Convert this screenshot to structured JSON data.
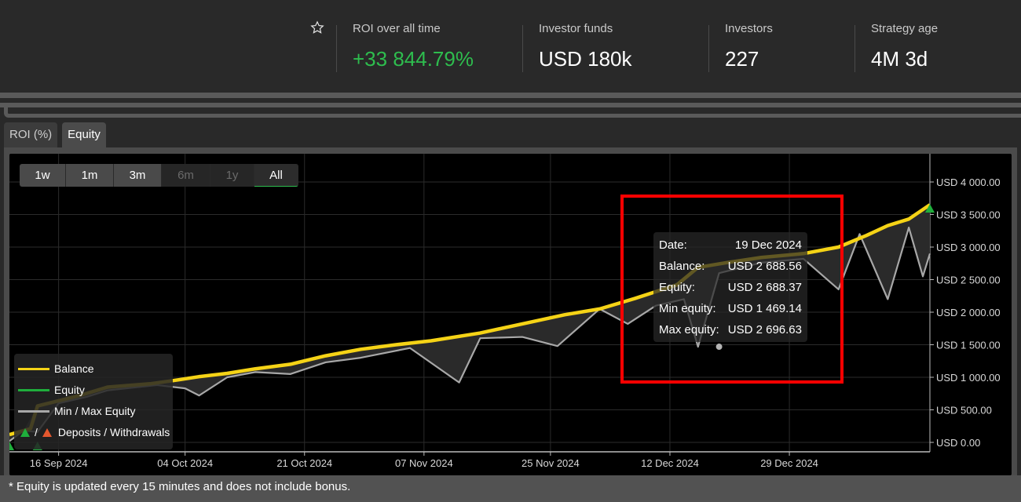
{
  "header": {
    "favorite_icon": "star-outline-icon",
    "stats": [
      {
        "label": "ROI over all time",
        "value": "+33 844.79%",
        "color": "#2ebd4e"
      },
      {
        "label": "Investor funds",
        "value": "USD 180k"
      },
      {
        "label": "Investors",
        "value": "227"
      },
      {
        "label": "Strategy age",
        "value": "4M 3d"
      }
    ]
  },
  "tabs": [
    {
      "label": "ROI (%)",
      "active": false
    },
    {
      "label": "Equity",
      "active": true
    }
  ],
  "ranges": [
    {
      "label": "1w",
      "state": "enabled"
    },
    {
      "label": "1m",
      "state": "enabled"
    },
    {
      "label": "3m",
      "state": "enabled"
    },
    {
      "label": "6m",
      "state": "disabled"
    },
    {
      "label": "1y",
      "state": "disabled"
    },
    {
      "label": "All",
      "state": "active"
    }
  ],
  "legend": {
    "balance": "Balance",
    "equity": "Equity",
    "minmax": "Min / Max Equity",
    "deposits_sep": "/",
    "deposits": "Deposits / Withdrawals"
  },
  "tooltip": {
    "date_label": "Date:",
    "date_value": "19 Dec 2024",
    "balance_label": "Balance:",
    "balance_value": "USD 2 688.56",
    "equity_label": "Equity:",
    "equity_value": "USD 2 688.37",
    "min_label": "Min equity:",
    "min_value": "USD 1 469.14",
    "max_label": "Max equity:",
    "max_value": "USD 2 696.63"
  },
  "footnote": "* Equity is updated every 15 minutes and does not include bonus.",
  "colors": {
    "balance": "#f5d316",
    "equity": "#1fae3c",
    "minmax": "#a8a8a8",
    "deposit": "#1fae3c",
    "withdrawal": "#e4572e",
    "highlight": "#ff0000"
  },
  "chart_data": {
    "type": "line",
    "title": "",
    "xlabel": "",
    "ylabel": "",
    "ylim": [
      0,
      4000
    ],
    "xlim": [
      "2024-09-09",
      "2025-01-11"
    ],
    "grid": true,
    "legend_position": "bottom-left",
    "y_ticks": [
      "USD 0.00",
      "USD 500.00",
      "USD 1 000.00",
      "USD 1 500.00",
      "USD 2 000.00",
      "USD 2 500.00",
      "USD 3 000.00",
      "USD 3 500.00",
      "USD 4 000.00"
    ],
    "y_tick_values": [
      0,
      500,
      1000,
      1500,
      2000,
      2500,
      3000,
      3500,
      4000
    ],
    "x_ticks": [
      "16 Sep 2024",
      "04 Oct 2024",
      "21 Oct 2024",
      "07 Nov 2024",
      "25 Nov 2024",
      "12 Dec 2024",
      "29 Dec 2024"
    ],
    "x_tick_days": [
      7,
      25,
      42,
      59,
      77,
      94,
      111
    ],
    "series": [
      {
        "name": "Balance",
        "day": [
          0,
          3,
          4,
          7,
          10,
          14,
          20,
          24,
          27,
          31,
          35,
          40,
          45,
          50,
          55,
          60,
          67,
          73,
          79,
          84,
          89,
          95,
          98,
          102,
          107,
          113,
          118,
          122,
          125,
          128,
          131
        ],
        "values": [
          120,
          210,
          560,
          640,
          720,
          850,
          900,
          960,
          1010,
          1060,
          1130,
          1200,
          1330,
          1430,
          1500,
          1560,
          1680,
          1820,
          1960,
          2050,
          2210,
          2420,
          2688,
          2760,
          2840,
          2900,
          3000,
          3180,
          3330,
          3430,
          3650
        ]
      },
      {
        "name": "Min equity",
        "day": [
          0,
          2,
          4,
          7,
          11,
          14,
          21,
          25,
          27,
          31,
          35,
          40,
          45,
          50,
          57,
          64,
          67,
          73,
          78,
          84,
          88,
          92,
          96,
          98,
          101,
          107,
          113,
          118,
          121,
          125,
          128,
          130,
          131
        ],
        "values": [
          20,
          180,
          160,
          600,
          700,
          800,
          880,
          830,
          720,
          1000,
          1080,
          1050,
          1230,
          1300,
          1450,
          920,
          1600,
          1620,
          1480,
          2050,
          1820,
          2100,
          2200,
          1469,
          2600,
          2760,
          2820,
          2350,
          3200,
          2200,
          3300,
          2550,
          2900
        ]
      }
    ],
    "markers": [
      {
        "type": "deposit",
        "day": 0
      },
      {
        "type": "deposit",
        "day": 4
      },
      {
        "type": "deposit",
        "day": 131
      }
    ],
    "hover": {
      "date": "19 Dec 2024",
      "day": 101,
      "balance": 2688.56,
      "equity": 2688.37,
      "min_equity": 1469.14,
      "max_equity": 2696.63
    }
  }
}
